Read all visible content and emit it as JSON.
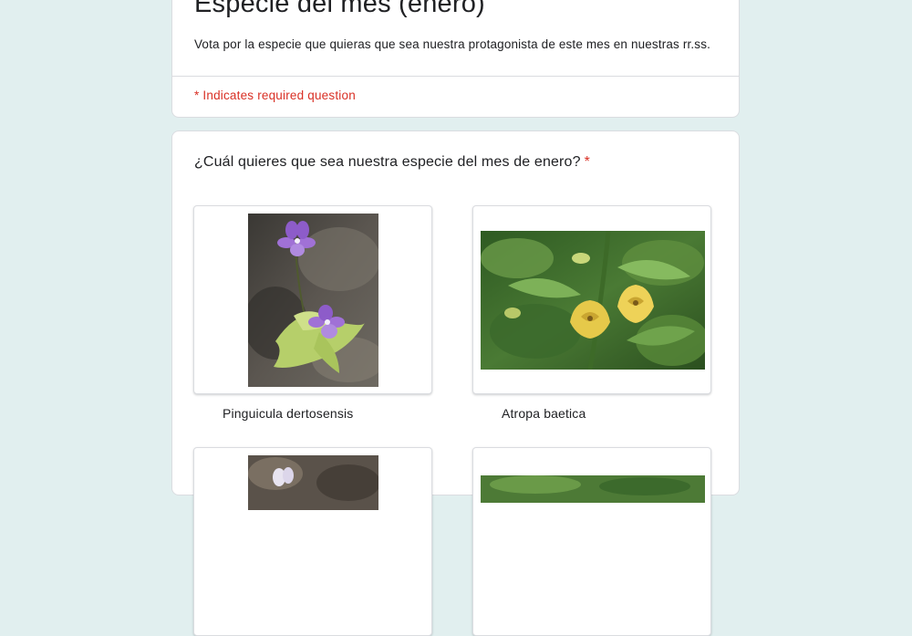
{
  "form": {
    "title": "Especie del mes (enero)",
    "description": "Vota por la especie que quieras que sea nuestra protagonista de este mes en nuestras rr.ss.",
    "required_note": "* Indicates required question"
  },
  "question": {
    "text": "¿Cuál quieres que sea nuestra especie del mes de enero?",
    "required_marker": "*",
    "options": [
      {
        "label": "Pinguicula dertosensis",
        "image_icon": "pinguicula-photo"
      },
      {
        "label": "Atropa baetica",
        "image_icon": "atropa-photo"
      }
    ]
  },
  "colors": {
    "background": "#e1efef",
    "required_red": "#d93025",
    "card": "#ffffff",
    "border": "#dadce0"
  }
}
